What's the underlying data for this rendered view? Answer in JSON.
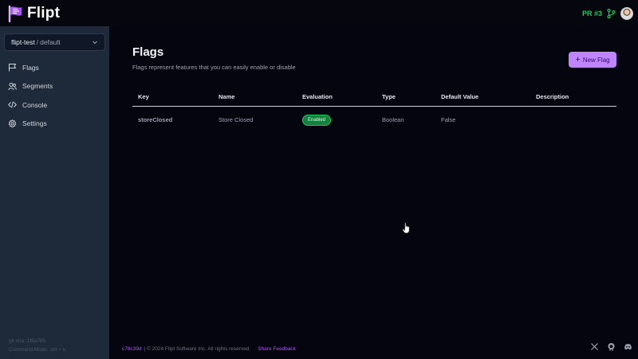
{
  "app": {
    "name": "Flipt"
  },
  "topbar": {
    "pr_label": "PR #3"
  },
  "sidebar": {
    "namespace": {
      "project": "flipt-test",
      "separator": "/",
      "env": "default"
    },
    "items": [
      {
        "label": "Flags",
        "icon": "flag-icon"
      },
      {
        "label": "Segments",
        "icon": "users-icon"
      },
      {
        "label": "Console",
        "icon": "code-icon"
      },
      {
        "label": "Settings",
        "icon": "gear-icon"
      }
    ],
    "footer": {
      "git_sha": "git sha: 1f6a785",
      "command_mode": "Command Mode: ctrl + k"
    }
  },
  "main": {
    "title": "Flags",
    "subtitle": "Flags represent features that you can easily enable or disable",
    "new_flag_label": "New Flag",
    "table": {
      "headers": [
        "Key",
        "Name",
        "Evaluation",
        "Type",
        "Default Value",
        "Description"
      ],
      "rows": [
        {
          "key": "storeClosed",
          "name": "Store Closed",
          "evaluation": "Enabled",
          "type": "Boolean",
          "default_value": "False",
          "description": ""
        }
      ]
    }
  },
  "footer": {
    "sha": "c78c39d",
    "copyright": "| © 2024 Flipt Software Inc. All rights reserved.",
    "feedback": "Share Feedback",
    "socials": [
      "x-icon",
      "github-icon",
      "discord-icon"
    ]
  },
  "colors": {
    "accent": "#c084fc",
    "enabled": "#15803d",
    "pr": "#22c55e",
    "sidebar": "#1e2a3a",
    "background": "#05050f"
  }
}
